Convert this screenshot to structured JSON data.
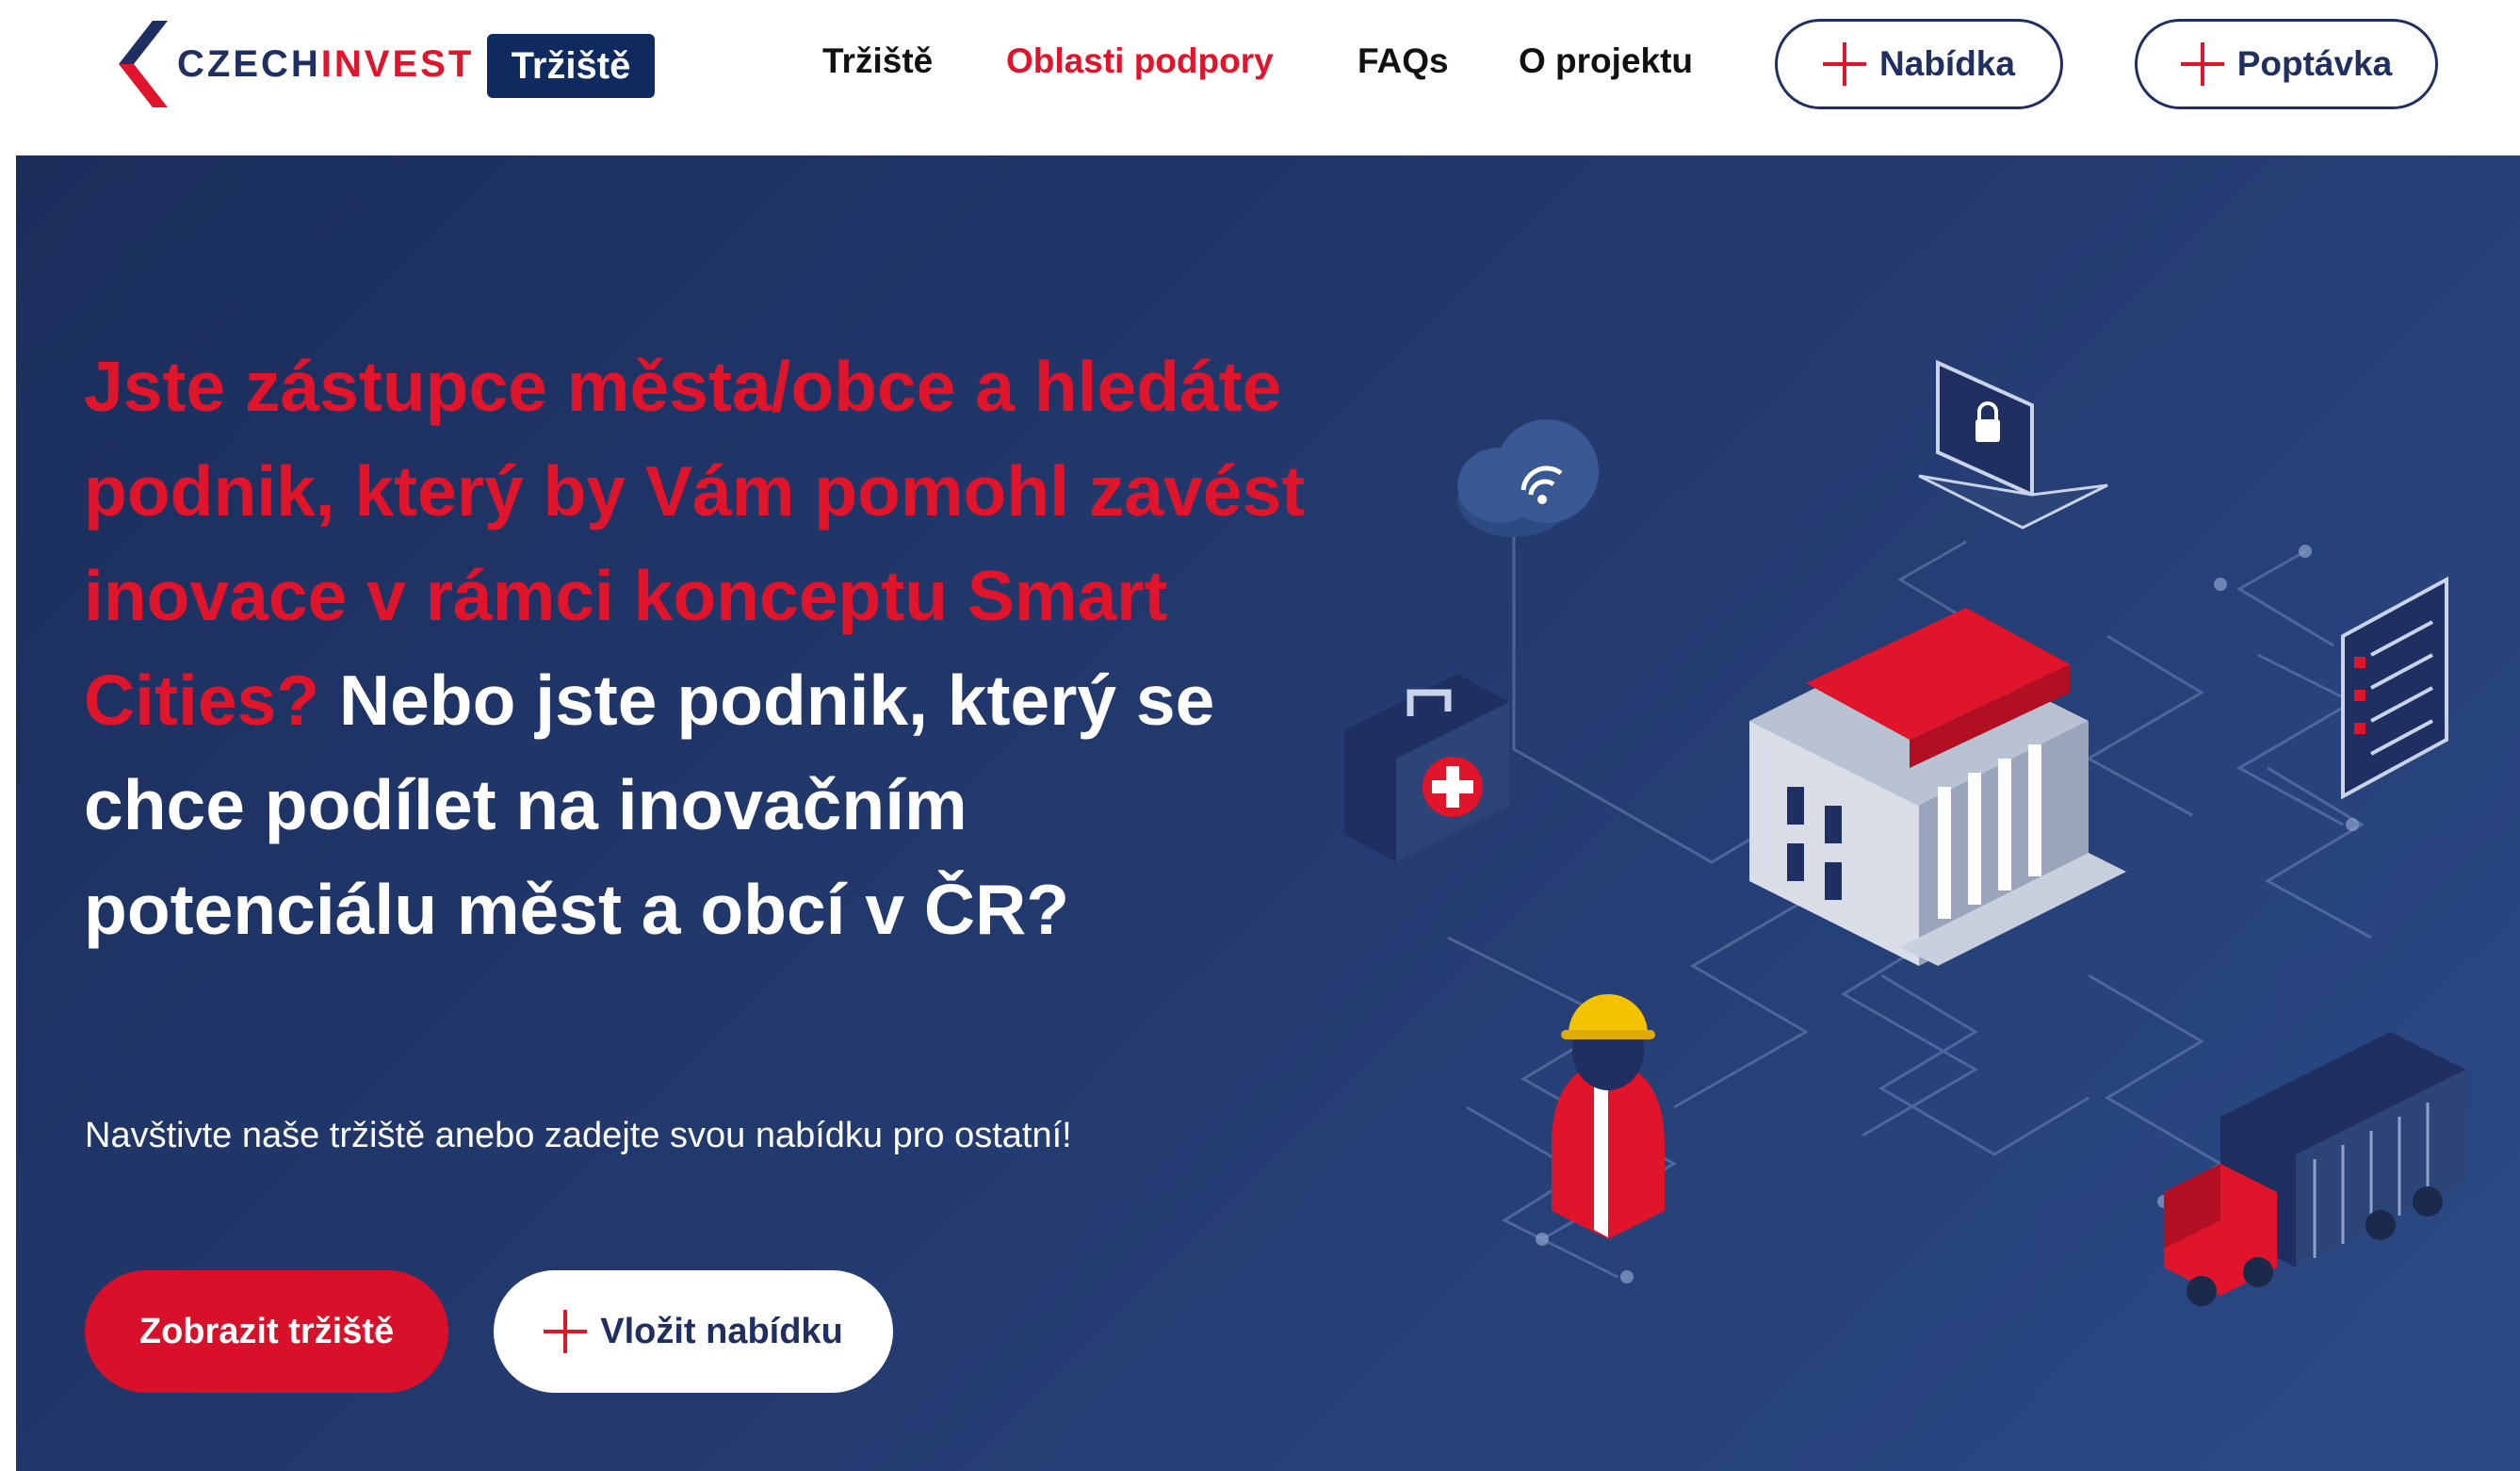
{
  "header": {
    "logo": {
      "czech": "CZECH",
      "invest": "INVEST",
      "badge": "Tržiště"
    },
    "nav": [
      {
        "label": "Tržiště",
        "active": false
      },
      {
        "label": "Oblasti podpory",
        "active": true
      },
      {
        "label": "FAQs",
        "active": false
      },
      {
        "label": "O projektu",
        "active": false
      }
    ],
    "actions": {
      "offer": "Nabídka",
      "demand": "Poptávka"
    }
  },
  "hero": {
    "headline_red": "Jste zástupce města/obce a hledáte podnik, který by Vám pomohl zavést inovace v rámci konceptu Smart Cities?",
    "headline_white": "Nebo jste podnik, který se chce podílet na inovačním potenciálu měst a obcí v ČR?",
    "subtitle": "Navštivte naše tržiště anebo zadejte svou nabídku pro ostatní!",
    "primary_button": "Zobrazit tržiště",
    "secondary_button": "Vložit nabídku"
  },
  "colors": {
    "accent_red": "#e0142b",
    "navy": "#1f2f61",
    "hero_bg": "#243c72"
  },
  "icons": [
    "czechinvest-logo",
    "plus-icon",
    "cloud-wifi-icon",
    "laptop-lock-icon",
    "checklist-icon",
    "medical-case-icon",
    "city-hall-icon",
    "construction-worker-icon",
    "truck-icon"
  ]
}
